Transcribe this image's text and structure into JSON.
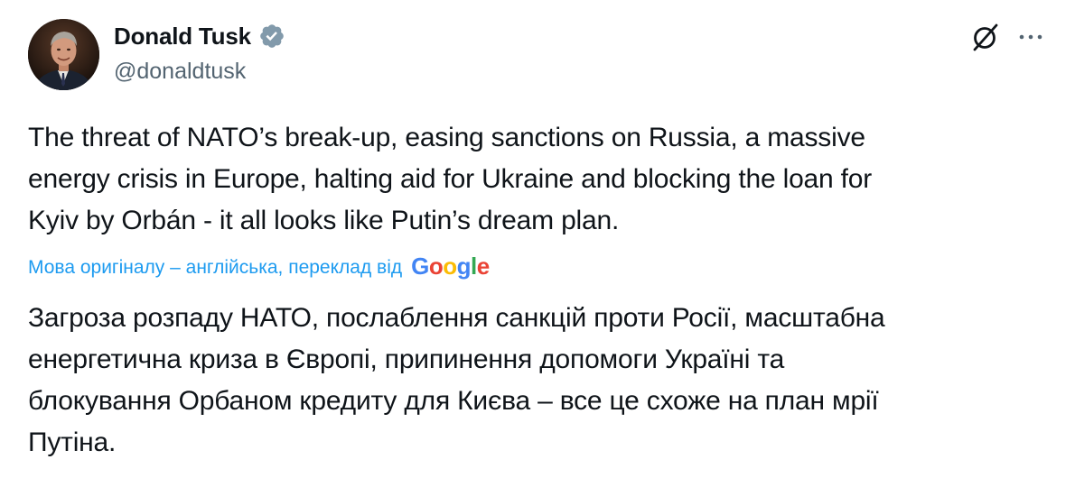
{
  "author": {
    "display_name": "Donald Tusk",
    "handle": "@donaldtusk",
    "verified_color": "#829aab"
  },
  "tweet": {
    "text_lines": [
      "The threat of NATO’s break-up, easing sanctions on Russia, a massive",
      "energy crisis in Europe, halting aid for Ukraine and blocking the loan for",
      "Kyiv by Orbán - it all looks like Putin’s dream plan."
    ]
  },
  "translation": {
    "label": "Мова оригіналу – англійська, переклад від",
    "provider_letters": [
      "G",
      "o",
      "o",
      "g",
      "l",
      "e"
    ],
    "provider_colors": [
      "#4285f4",
      "#ea4335",
      "#fbbc05",
      "#4285f4",
      "#34a853",
      "#ea4335"
    ],
    "text_lines": [
      "Загроза розпаду НАТО, послаблення санкцій проти Росії, масштабна",
      "енергетична криза в Європі, припинення допомоги Україні та",
      "блокування Орбаном кредиту для Києва – все це схоже на план мрії",
      "Путіна."
    ]
  },
  "colors": {
    "link_blue": "#1d9bf0",
    "secondary_text": "#536471",
    "primary_text": "#0f1419"
  },
  "icons": {
    "verified": "verified-badge-icon",
    "grok": "grok-icon",
    "more": "more-icon"
  }
}
